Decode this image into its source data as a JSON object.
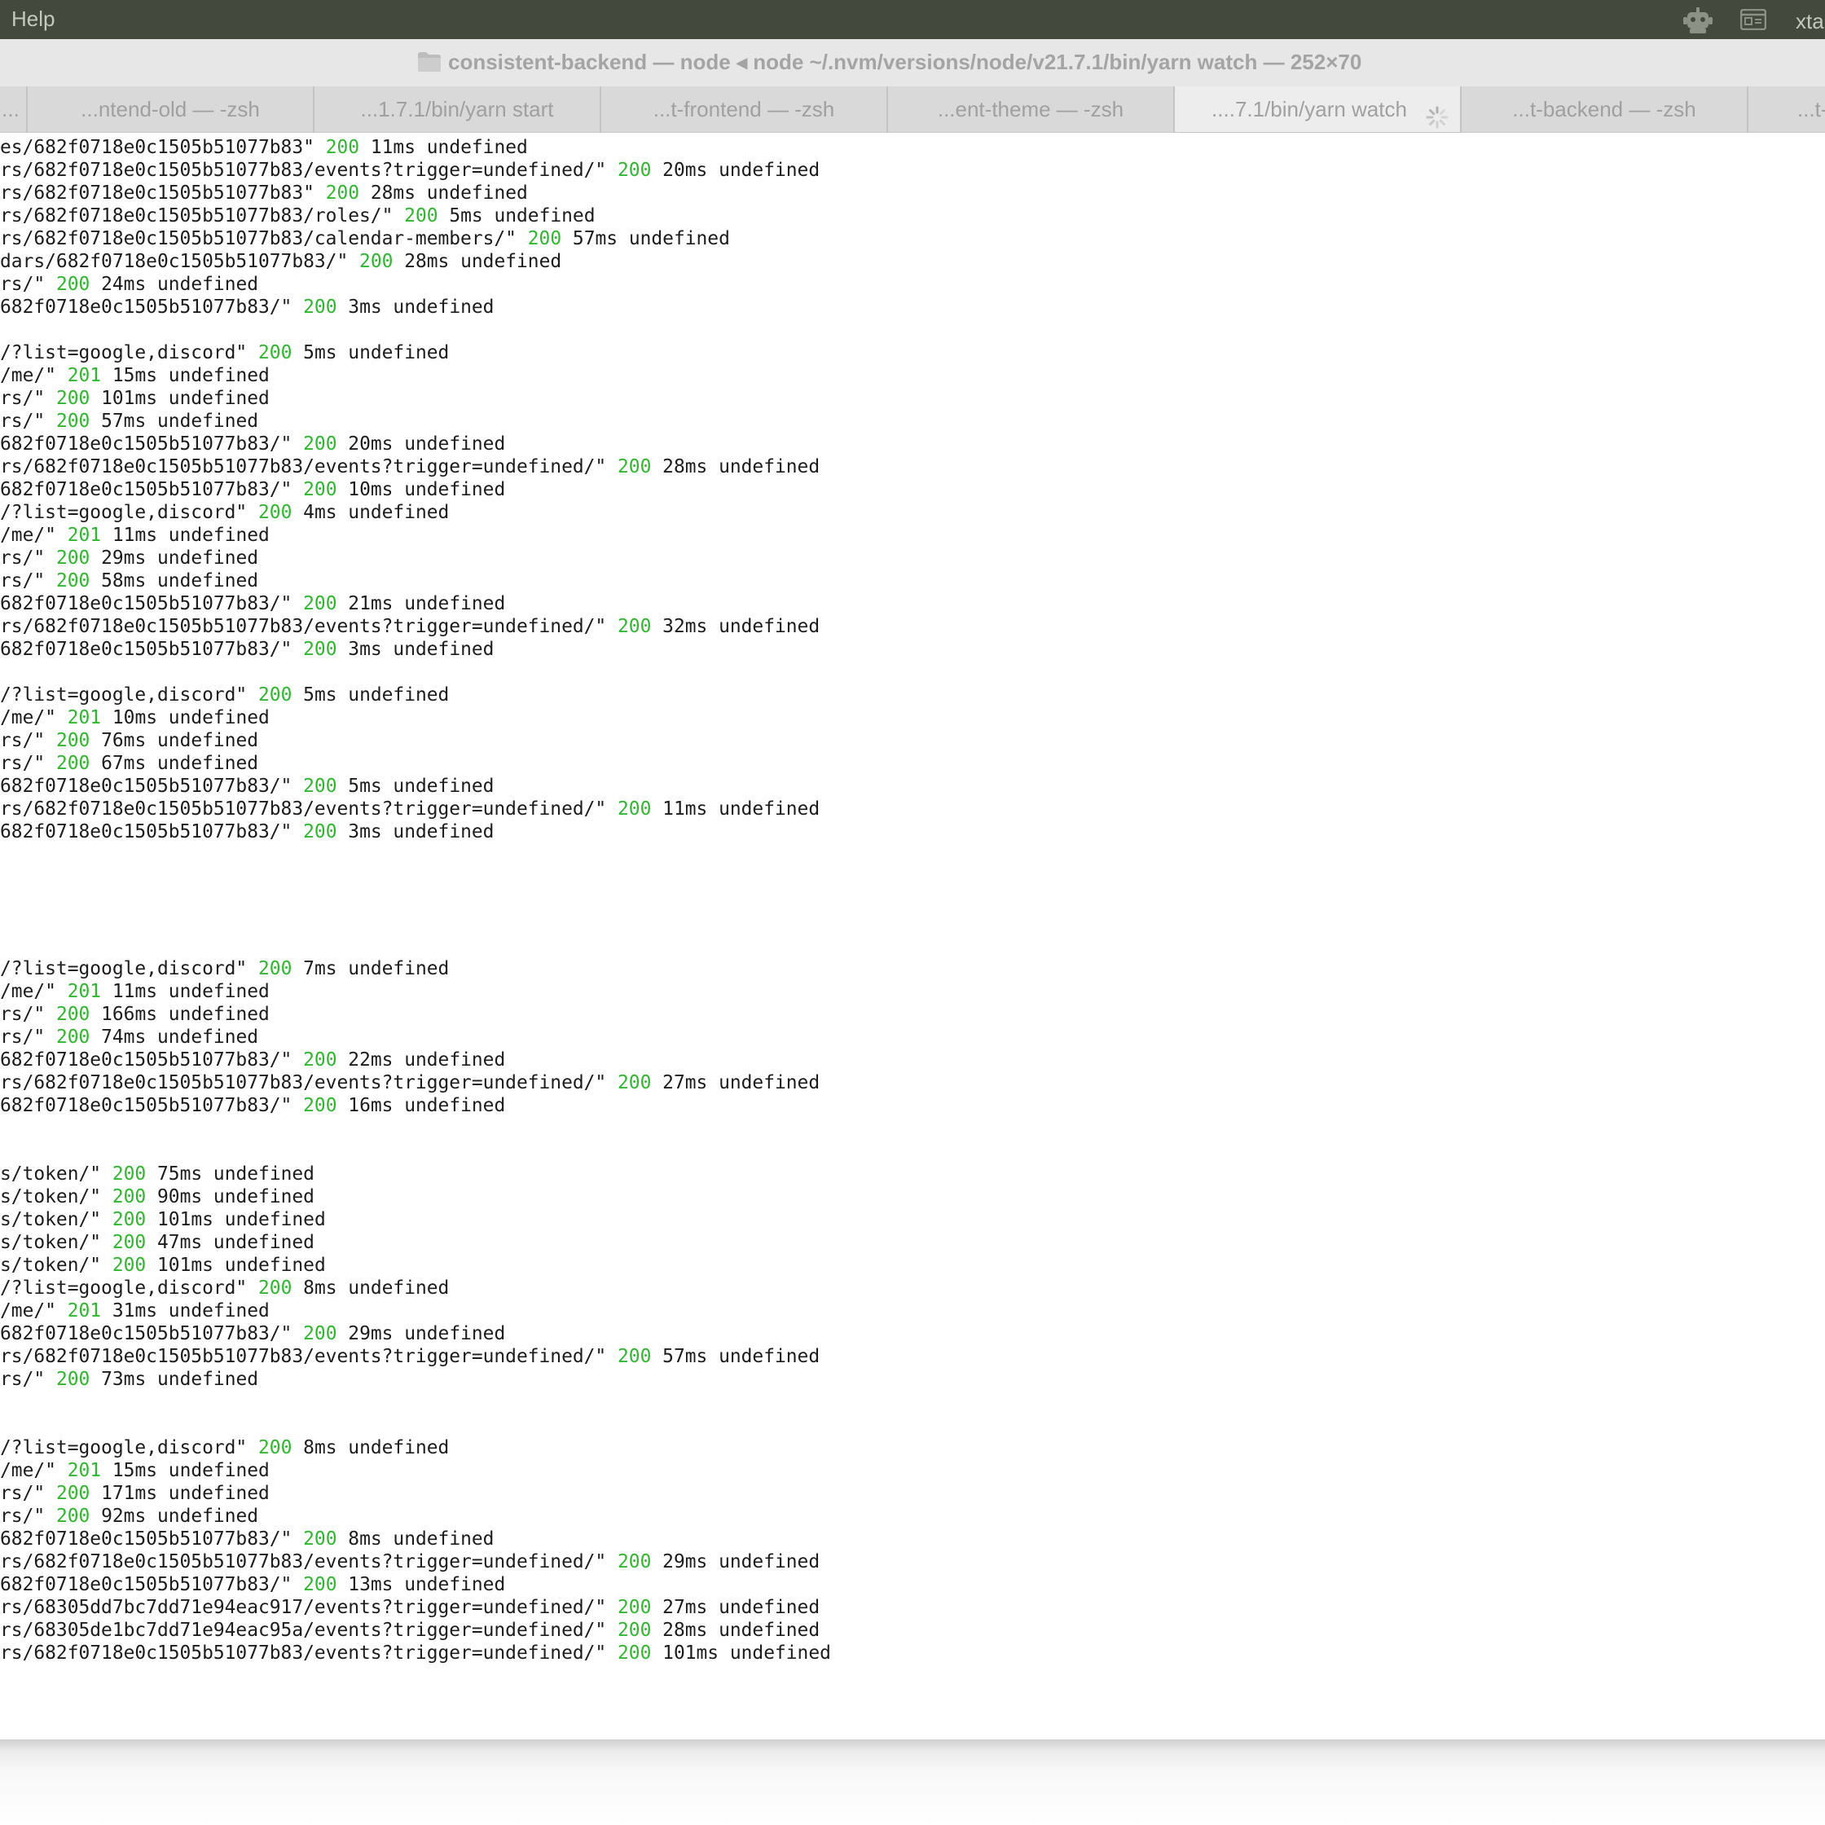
{
  "menubar": {
    "help_label": "Help",
    "robot_icon": "robot-icon",
    "window_icon": "window-icon",
    "user_label": "xta"
  },
  "window": {
    "title": "consistent-backend — node ◂ node ~/.nvm/versions/node/v21.7.1/bin/yarn watch — 252×70"
  },
  "tabs": [
    {
      "label": "..."
    },
    {
      "label": "...ntend-old — -zsh"
    },
    {
      "label": "...1.7.1/bin/yarn start"
    },
    {
      "label": "...t-frontend — -zsh"
    },
    {
      "label": "...ent-theme — -zsh"
    },
    {
      "label": "....7.1/bin/yarn watch",
      "active": true
    },
    {
      "label": "...t-backend — -zsh"
    },
    {
      "label": "...t-"
    }
  ],
  "log_lines": [
    {
      "path": "es/682f0718e0c1505b51077b83\"",
      "status": "200",
      "rest": "11ms undefined"
    },
    {
      "path": "rs/682f0718e0c1505b51077b83/events?trigger=undefined/\"",
      "status": "200",
      "rest": "20ms undefined"
    },
    {
      "path": "rs/682f0718e0c1505b51077b83\"",
      "status": "200",
      "rest": "28ms undefined"
    },
    {
      "path": "rs/682f0718e0c1505b51077b83/roles/\"",
      "status": "200",
      "rest": "5ms undefined"
    },
    {
      "path": "rs/682f0718e0c1505b51077b83/calendar-members/\"",
      "status": "200",
      "rest": "57ms undefined"
    },
    {
      "path": "dars/682f0718e0c1505b51077b83/\"",
      "status": "200",
      "rest": "28ms undefined"
    },
    {
      "path": "rs/\"",
      "status": "200",
      "rest": "24ms undefined"
    },
    {
      "path": "682f0718e0c1505b51077b83/\"",
      "status": "200",
      "rest": "3ms undefined"
    },
    {
      "path": "",
      "status": "",
      "rest": ""
    },
    {
      "path": "/?list=google,discord\"",
      "status": "200",
      "rest": "5ms undefined"
    },
    {
      "path": "/me/\"",
      "status": "201",
      "rest": "15ms undefined"
    },
    {
      "path": "rs/\"",
      "status": "200",
      "rest": "101ms undefined"
    },
    {
      "path": "rs/\"",
      "status": "200",
      "rest": "57ms undefined"
    },
    {
      "path": "682f0718e0c1505b51077b83/\"",
      "status": "200",
      "rest": "20ms undefined"
    },
    {
      "path": "rs/682f0718e0c1505b51077b83/events?trigger=undefined/\"",
      "status": "200",
      "rest": "28ms undefined"
    },
    {
      "path": "682f0718e0c1505b51077b83/\"",
      "status": "200",
      "rest": "10ms undefined"
    },
    {
      "path": "/?list=google,discord\"",
      "status": "200",
      "rest": "4ms undefined"
    },
    {
      "path": "/me/\"",
      "status": "201",
      "rest": "11ms undefined"
    },
    {
      "path": "rs/\"",
      "status": "200",
      "rest": "29ms undefined"
    },
    {
      "path": "rs/\"",
      "status": "200",
      "rest": "58ms undefined"
    },
    {
      "path": "682f0718e0c1505b51077b83/\"",
      "status": "200",
      "rest": "21ms undefined"
    },
    {
      "path": "rs/682f0718e0c1505b51077b83/events?trigger=undefined/\"",
      "status": "200",
      "rest": "32ms undefined"
    },
    {
      "path": "682f0718e0c1505b51077b83/\"",
      "status": "200",
      "rest": "3ms undefined"
    },
    {
      "path": "",
      "status": "",
      "rest": ""
    },
    {
      "path": "/?list=google,discord\"",
      "status": "200",
      "rest": "5ms undefined"
    },
    {
      "path": "/me/\"",
      "status": "201",
      "rest": "10ms undefined"
    },
    {
      "path": "rs/\"",
      "status": "200",
      "rest": "76ms undefined"
    },
    {
      "path": "rs/\"",
      "status": "200",
      "rest": "67ms undefined"
    },
    {
      "path": "682f0718e0c1505b51077b83/\"",
      "status": "200",
      "rest": "5ms undefined"
    },
    {
      "path": "rs/682f0718e0c1505b51077b83/events?trigger=undefined/\"",
      "status": "200",
      "rest": "11ms undefined"
    },
    {
      "path": "682f0718e0c1505b51077b83/\"",
      "status": "200",
      "rest": "3ms undefined"
    },
    {
      "path": "",
      "status": "",
      "rest": ""
    },
    {
      "path": "",
      "status": "",
      "rest": ""
    },
    {
      "path": "",
      "status": "",
      "rest": ""
    },
    {
      "path": "",
      "status": "",
      "rest": ""
    },
    {
      "path": "",
      "status": "",
      "rest": ""
    },
    {
      "path": "/?list=google,discord\"",
      "status": "200",
      "rest": "7ms undefined"
    },
    {
      "path": "/me/\"",
      "status": "201",
      "rest": "11ms undefined"
    },
    {
      "path": "rs/\"",
      "status": "200",
      "rest": "166ms undefined"
    },
    {
      "path": "rs/\"",
      "status": "200",
      "rest": "74ms undefined"
    },
    {
      "path": "682f0718e0c1505b51077b83/\"",
      "status": "200",
      "rest": "22ms undefined"
    },
    {
      "path": "rs/682f0718e0c1505b51077b83/events?trigger=undefined/\"",
      "status": "200",
      "rest": "27ms undefined"
    },
    {
      "path": "682f0718e0c1505b51077b83/\"",
      "status": "200",
      "rest": "16ms undefined"
    },
    {
      "path": "",
      "status": "",
      "rest": ""
    },
    {
      "path": "",
      "status": "",
      "rest": ""
    },
    {
      "path": "s/token/\"",
      "status": "200",
      "rest": "75ms undefined"
    },
    {
      "path": "s/token/\"",
      "status": "200",
      "rest": "90ms undefined"
    },
    {
      "path": "s/token/\"",
      "status": "200",
      "rest": "101ms undefined"
    },
    {
      "path": "s/token/\"",
      "status": "200",
      "rest": "47ms undefined"
    },
    {
      "path": "s/token/\"",
      "status": "200",
      "rest": "101ms undefined"
    },
    {
      "path": "/?list=google,discord\"",
      "status": "200",
      "rest": "8ms undefined"
    },
    {
      "path": "/me/\"",
      "status": "201",
      "rest": "31ms undefined"
    },
    {
      "path": "682f0718e0c1505b51077b83/\"",
      "status": "200",
      "rest": "29ms undefined"
    },
    {
      "path": "rs/682f0718e0c1505b51077b83/events?trigger=undefined/\"",
      "status": "200",
      "rest": "57ms undefined"
    },
    {
      "path": "rs/\"",
      "status": "200",
      "rest": "73ms undefined"
    },
    {
      "path": "",
      "status": "",
      "rest": ""
    },
    {
      "path": "",
      "status": "",
      "rest": ""
    },
    {
      "path": "/?list=google,discord\"",
      "status": "200",
      "rest": "8ms undefined"
    },
    {
      "path": "/me/\"",
      "status": "201",
      "rest": "15ms undefined"
    },
    {
      "path": "rs/\"",
      "status": "200",
      "rest": "171ms undefined"
    },
    {
      "path": "rs/\"",
      "status": "200",
      "rest": "92ms undefined"
    },
    {
      "path": "682f0718e0c1505b51077b83/\"",
      "status": "200",
      "rest": "8ms undefined"
    },
    {
      "path": "rs/682f0718e0c1505b51077b83/events?trigger=undefined/\"",
      "status": "200",
      "rest": "29ms undefined"
    },
    {
      "path": "682f0718e0c1505b51077b83/\"",
      "status": "200",
      "rest": "13ms undefined"
    },
    {
      "path": "rs/68305dd7bc7dd71e94eac917/events?trigger=undefined/\"",
      "status": "200",
      "rest": "27ms undefined"
    },
    {
      "path": "rs/68305de1bc7dd71e94eac95a/events?trigger=undefined/\"",
      "status": "200",
      "rest": "28ms undefined"
    },
    {
      "path": "rs/682f0718e0c1505b51077b83/events?trigger=undefined/\"",
      "status": "200",
      "rest": "101ms undefined"
    }
  ],
  "colors": {
    "status_green": "#2eb82e",
    "menubar_bg": "#434a3d",
    "titlebar_bg": "#e7e7e7",
    "tab_bg": "#d9d9d9",
    "active_tab_bg": "#ededed"
  }
}
